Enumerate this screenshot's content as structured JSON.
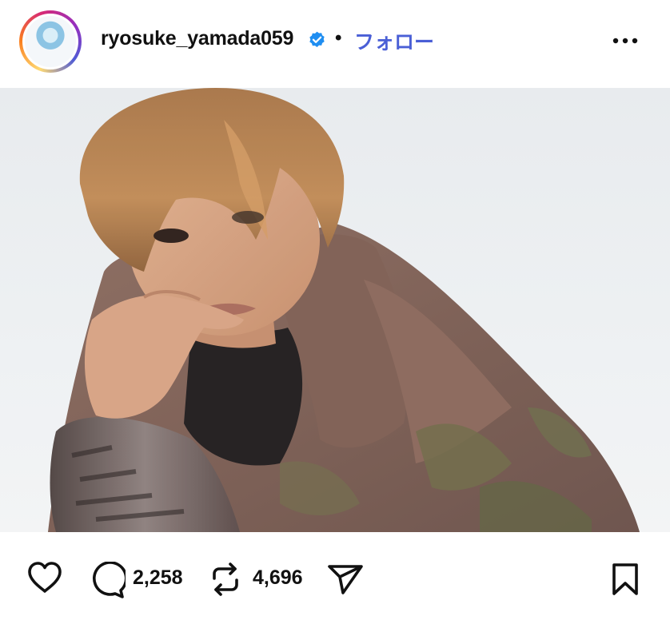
{
  "post": {
    "username": "ryosuke_yamada059",
    "separator": "•",
    "follow_label": "フォロー",
    "verified": true,
    "comments_count": "2,258",
    "reposts_count": "4,696"
  },
  "icons": {
    "avatar": "profile-avatar",
    "verified": "verified-badge-icon",
    "more": "more-options-icon",
    "like": "heart-icon",
    "comment": "comment-icon",
    "repost": "repost-icon",
    "share": "share-icon",
    "save": "bookmark-icon"
  },
  "colors": {
    "follow": "#4a5fd6",
    "verified": "#1f8ef1"
  }
}
